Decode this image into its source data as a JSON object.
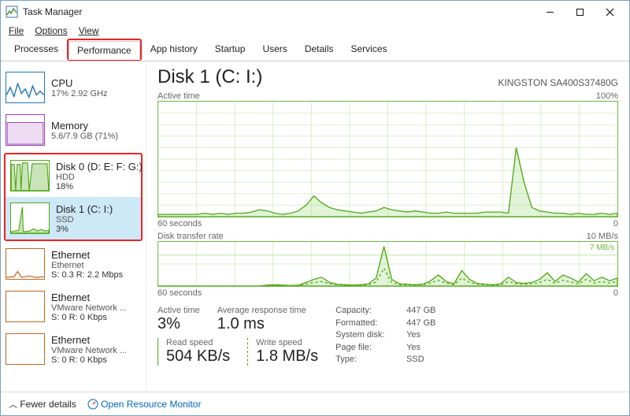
{
  "window": {
    "title": "Task Manager"
  },
  "menu": {
    "file": "File",
    "options": "Options",
    "view": "View"
  },
  "tabs": {
    "processes": "Processes",
    "performance": "Performance",
    "app_history": "App history",
    "startup": "Startup",
    "users": "Users",
    "details": "Details",
    "services": "Services"
  },
  "sidebar": {
    "items": [
      {
        "title": "CPU",
        "line2": "17% 2.92 GHz",
        "line3": ""
      },
      {
        "title": "Memory",
        "line2": "5.6/7.9 GB (71%)",
        "line3": ""
      },
      {
        "title": "Disk 0 (D: E: F: G:)",
        "line2": "HDD",
        "line3": "18%"
      },
      {
        "title": "Disk 1 (C: I:)",
        "line2": "SSD",
        "line3": "3%"
      },
      {
        "title": "Ethernet",
        "line2": "Ethernet",
        "line3": "S: 0.3 R: 2.2 Mbps"
      },
      {
        "title": "Ethernet",
        "line2": "VMware Network ...",
        "line3": "S: 0 R: 0 Kbps"
      },
      {
        "title": "Ethernet",
        "line2": "VMware Network ...",
        "line3": "S: 0 R: 0 Kbps"
      }
    ]
  },
  "main": {
    "title": "Disk 1 (C: I:)",
    "subtitle": "KINGSTON SA400S37480G",
    "chart1": {
      "label": "Active time",
      "max": "100%",
      "foot_left": "60 seconds",
      "foot_right": "0"
    },
    "chart2": {
      "label": "Disk transfer rate",
      "max": "10 MB/s",
      "inner": "7 MB/s",
      "foot_left": "60 seconds",
      "foot_right": "0"
    },
    "stats": {
      "active_time_label": "Active time",
      "active_time": "3%",
      "avg_resp_label": "Average response time",
      "avg_resp": "1.0 ms",
      "read_label": "Read speed",
      "read": "504 KB/s",
      "write_label": "Write speed",
      "write": "1.8 MB/s"
    },
    "kv": {
      "capacity_label": "Capacity:",
      "capacity": "447 GB",
      "formatted_label": "Formatted:",
      "formatted": "447 GB",
      "sysdisk_label": "System disk:",
      "sysdisk": "Yes",
      "pagefile_label": "Page file:",
      "pagefile": "Yes",
      "type_label": "Type:",
      "type": "SSD"
    }
  },
  "footer": {
    "fewer": "Fewer details",
    "orm": "Open Resource Monitor"
  },
  "chart_data": [
    {
      "type": "line",
      "title": "Active time",
      "ylabel": "Active time %",
      "ylim": [
        0,
        100
      ],
      "xlabel": "seconds",
      "xrange": [
        60,
        0
      ],
      "values": [
        2,
        2,
        2,
        2,
        2,
        2,
        3,
        2,
        3,
        2,
        3,
        3,
        4,
        6,
        5,
        3,
        2,
        3,
        5,
        10,
        18,
        12,
        8,
        6,
        5,
        4,
        3,
        4,
        5,
        8,
        6,
        5,
        4,
        5,
        4,
        3,
        3,
        4,
        3,
        3,
        3,
        3,
        4,
        4,
        4,
        3,
        60,
        30,
        8,
        5,
        4,
        3,
        3,
        2,
        3,
        2,
        2,
        3,
        2,
        3
      ]
    },
    {
      "type": "line",
      "title": "Disk transfer rate",
      "ylabel": "MB/s",
      "ylim": [
        0,
        10
      ],
      "xlabel": "seconds",
      "xrange": [
        60,
        0
      ],
      "series": [
        {
          "name": "Read",
          "values": [
            0,
            0,
            0,
            0,
            0,
            0,
            0,
            0,
            0,
            0,
            0,
            0,
            0,
            0,
            0.2,
            0.3,
            0.2,
            0.1,
            0.2,
            0.8,
            1.5,
            2.0,
            0.8,
            0.4,
            0.3,
            0.2,
            0.3,
            0.5,
            1.8,
            9.0,
            1.5,
            0.5,
            0.4,
            0.3,
            0.4,
            1.2,
            2.5,
            1.0,
            0.5,
            3.5,
            1.5,
            0.6,
            0.4,
            0.3,
            0.5,
            2.0,
            0.8,
            0.6,
            0.8,
            1.5,
            3.0,
            1.0,
            2.5,
            1.8,
            0.9,
            2.8,
            1.2,
            2.0,
            1.2,
            1.8
          ]
        },
        {
          "name": "Write",
          "values": [
            0,
            0,
            0,
            0,
            0,
            0,
            0,
            0,
            0,
            0,
            0,
            0,
            0,
            0,
            0.1,
            0.2,
            0.1,
            0.1,
            0.1,
            0.4,
            0.8,
            1.0,
            0.5,
            0.3,
            0.2,
            0.1,
            0.2,
            0.3,
            0.9,
            4.0,
            0.8,
            0.3,
            0.3,
            0.2,
            0.3,
            0.7,
            1.3,
            0.6,
            0.3,
            1.8,
            0.8,
            0.4,
            0.3,
            0.2,
            0.3,
            1.0,
            0.5,
            0.4,
            0.5,
            0.8,
            1.5,
            0.6,
            1.3,
            0.9,
            0.5,
            1.5,
            0.7,
            1.0,
            0.7,
            1.0
          ]
        }
      ]
    }
  ]
}
